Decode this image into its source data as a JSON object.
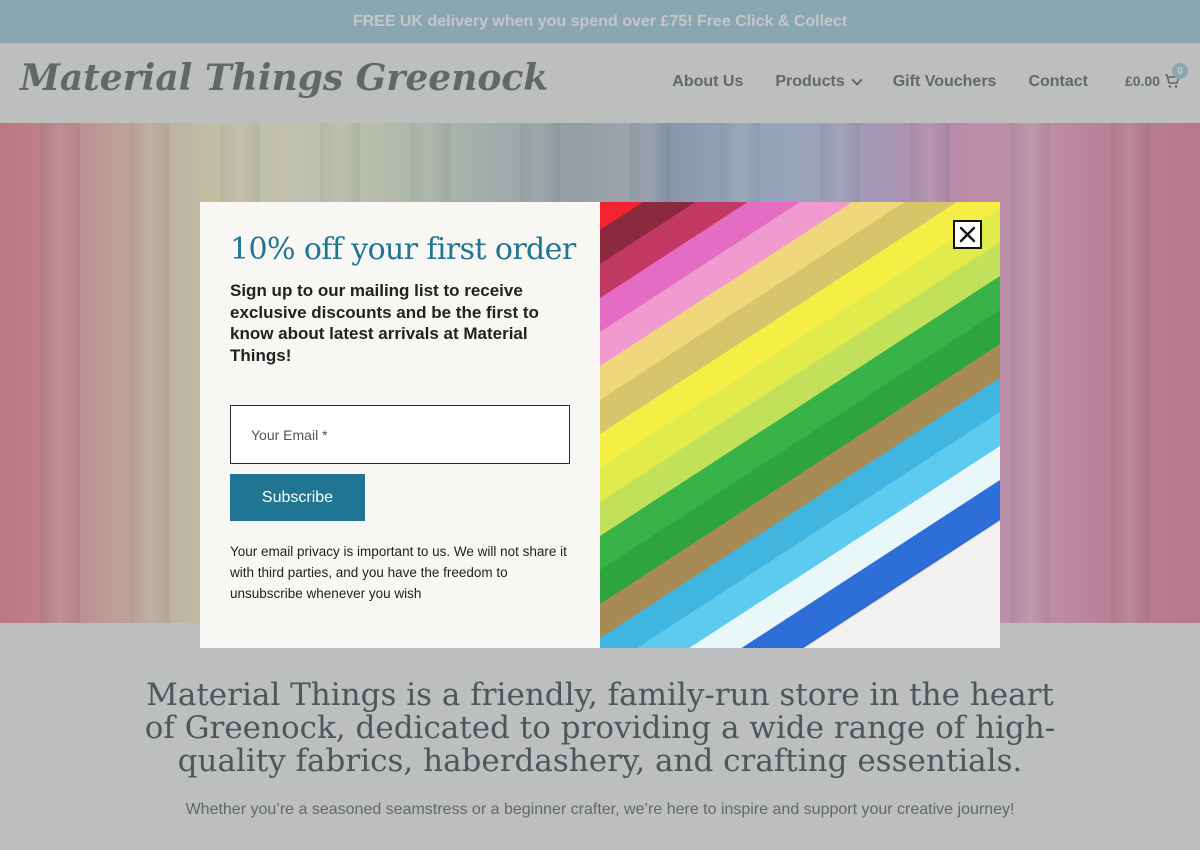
{
  "announcement": {
    "text": "FREE UK delivery when you spend over £75! Free Click & Collect"
  },
  "header": {
    "logo": "Material Things Greenock",
    "nav": [
      {
        "label": "About Us"
      },
      {
        "label": "Products",
        "has_dropdown": true
      },
      {
        "label": "Gift Vouchers"
      },
      {
        "label": "Contact"
      }
    ],
    "cart": {
      "amount": "£0.00",
      "count": "0"
    }
  },
  "intro": {
    "title": "Material Things is a friendly, family-run store in the heart of Greenock, dedicated to providing a wide range of high-quality fabrics, haberdashery, and crafting essentials.",
    "subtitle": "Whether you’re a seasoned seamstress or a beginner crafter, we’re here to inspire and support your creative journey!"
  },
  "modal": {
    "title": "10% off your first order",
    "text": "Sign up to our mailing list to receive exclusive discounts and be the first to know about latest arrivals at Material Things!",
    "email_placeholder": "Your Email *",
    "email_value": "",
    "subscribe_label": "Subscribe",
    "privacy": "Your email privacy is important to us. We will not share it with third parties, and you have the freedom to unsubscribe whenever you wish",
    "image": "colorful-fabric-swatches",
    "close_icon": "close-icon"
  },
  "colors": {
    "accent": "#1f7592",
    "announce_bg": "#a9cfdc",
    "text_muted": "#6f7274",
    "fabric_stripes": [
      "#e84a5f",
      "#f3232f",
      "#8b2a3f",
      "#c23a63",
      "#e46cc2",
      "#f19ad0",
      "#f0d77c",
      "#d8c46a",
      "#f5ef45",
      "#e2eb4c",
      "#c3e05b",
      "#37b348",
      "#2fa33c",
      "#a88a54",
      "#40b5e0",
      "#5dcaf0",
      "#e9f7f8",
      "#2d6ed9"
    ]
  }
}
